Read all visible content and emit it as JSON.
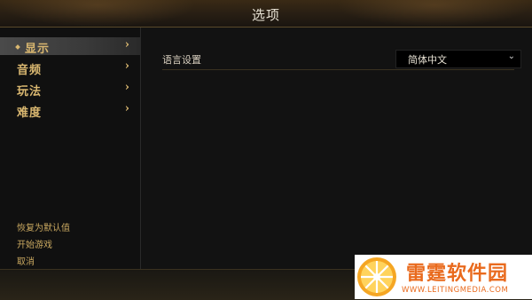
{
  "header": {
    "title": "选项"
  },
  "sidebar": {
    "items": [
      {
        "label": "显示",
        "chevron": "›",
        "active": true
      },
      {
        "label": "音频",
        "chevron": "›"
      },
      {
        "label": "玩法",
        "chevron": "›"
      },
      {
        "label": "难度",
        "chevron": "›"
      }
    ],
    "footer": {
      "reset_label": "恢复为默认值",
      "start_label": "开始游戏",
      "cancel_label": "取消"
    }
  },
  "main": {
    "language_setting": {
      "label": "语言设置",
      "value": "简体中文",
      "caret": "⌄"
    }
  },
  "watermark": {
    "name": "雷霆软件园",
    "url": "WWW.LEITINGMEDIA.COM"
  },
  "colors": {
    "accent_gold": "#d9b770",
    "watermark_orange": "#e96a1d"
  }
}
